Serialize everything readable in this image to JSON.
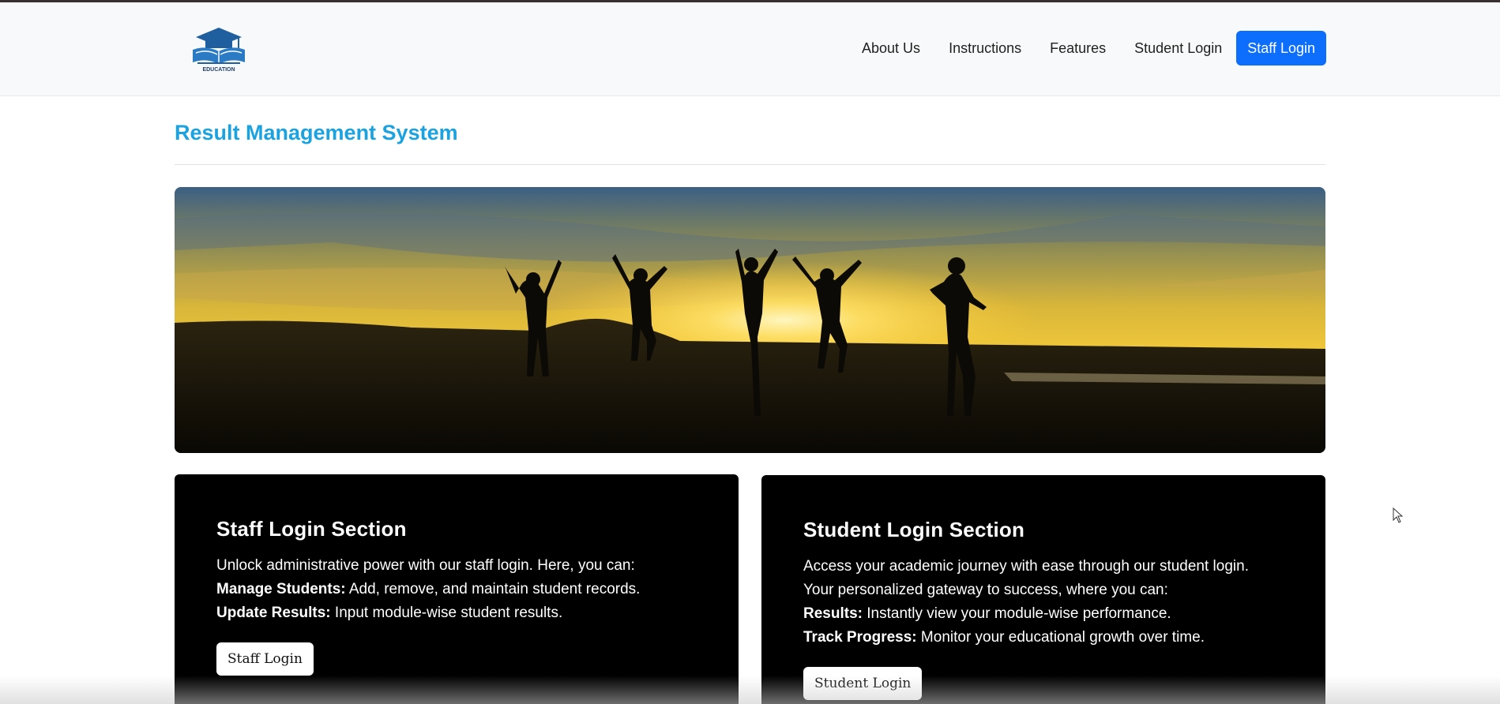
{
  "logo": {
    "text": "EDUCATION",
    "icon": "graduation-cap-book-icon"
  },
  "nav": {
    "links": [
      "About Us",
      "Instructions",
      "Features",
      "Student Login"
    ],
    "cta": "Staff Login"
  },
  "page": {
    "title": "Result Management System"
  },
  "hero": {
    "image": "silhouettes-jumping-at-sunset-beach"
  },
  "staff_section": {
    "heading": "Staff Login Section",
    "intro": "Unlock administrative power with our staff login. Here, you can:",
    "items": [
      {
        "label": "Manage Students:",
        "text": " Add, remove, and maintain student records."
      },
      {
        "label": "Update Results:",
        "text": " Input module-wise student results."
      }
    ],
    "button": "Staff Login"
  },
  "student_section": {
    "heading": "Student Login Section",
    "intro_1": "Access your academic journey with ease through our student login.",
    "intro_2": "Your personalized gateway to success, where you can:",
    "items": [
      {
        "label": "Results:",
        "text": " Instantly view your module-wise performance."
      },
      {
        "label": "Track Progress:",
        "text": " Monitor your educational growth over time."
      }
    ],
    "button": "Student Login"
  },
  "colors": {
    "accent": "#1aa3e0",
    "primary_button": "#0d6efd",
    "card_bg": "#000000"
  }
}
